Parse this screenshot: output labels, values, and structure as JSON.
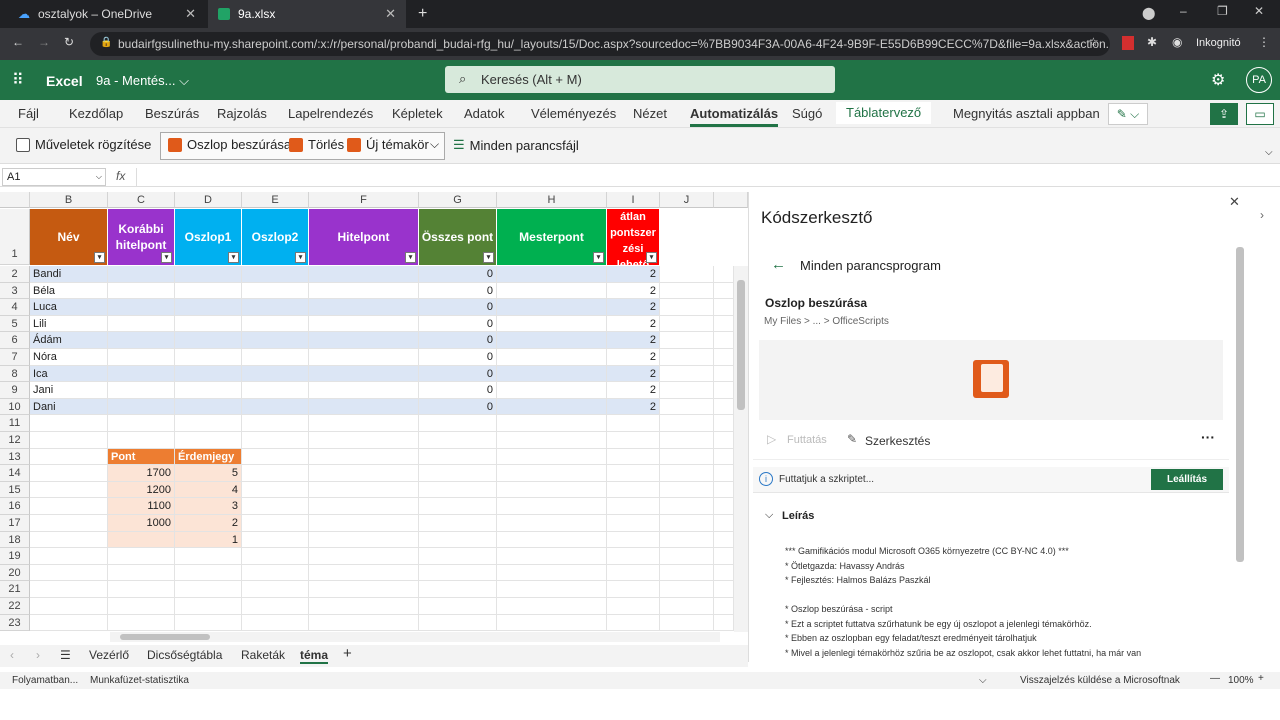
{
  "browser": {
    "tabs": [
      {
        "label": "osztalyok – OneDrive"
      },
      {
        "label": "9a.xlsx"
      }
    ],
    "url": "budairfgsulinethu-my.sharepoint.com/:x:/r/personal/probandi_budai-rfg_hu/_layouts/15/Doc.aspx?sourcedoc=%7BB9034F3A-00A6-4F24-9B9F-E55D6B99CECC%7D&file=9a.xlsx&action...",
    "profile": "Inkognitó"
  },
  "app": {
    "name": "Excel",
    "doc_title": "9a - Mentés... ⌵",
    "search_placeholder": "Keresés (Alt + M)",
    "avatar": "PA"
  },
  "menu": [
    "Fájl",
    "Kezdőlap",
    "Beszúrás",
    "Rajzolás",
    "Lapelrendezés",
    "Képletek",
    "Adatok",
    "Véleményezés",
    "Nézet",
    "Automatizálás",
    "Súgó",
    "Táblatervező"
  ],
  "menu_extra": "Megnyitás asztali appban",
  "ribbon": {
    "record": "Műveletek rögzítése",
    "insert_col": "Oszlop beszúrása",
    "delete": "Törlés",
    "new_topic": "Új témakör",
    "all_scripts": "Minden parancsfájl"
  },
  "formula": {
    "namebox": "A1",
    "fx": "fx"
  },
  "columns": [
    "B",
    "C",
    "D",
    "E",
    "F",
    "G",
    "H",
    "I",
    "J"
  ],
  "headers": [
    "Név",
    "Korábbi hitelpont",
    "Oszlop1",
    "Oszlop2",
    "Hitelpont",
    "Összes pont",
    "Mesterpont",
    "átlan pontszer zési lehető"
  ],
  "rows": [
    {
      "name": "Bandi",
      "total": "0",
      "i": "2"
    },
    {
      "name": "Béla",
      "total": "0",
      "i": "2"
    },
    {
      "name": "Luca",
      "total": "0",
      "i": "2"
    },
    {
      "name": "Lili",
      "total": "0",
      "i": "2"
    },
    {
      "name": "Ádám",
      "total": "0",
      "i": "2"
    },
    {
      "name": "Nóra",
      "total": "0",
      "i": "2"
    },
    {
      "name": "Ica",
      "total": "0",
      "i": "2"
    },
    {
      "name": "Jani",
      "total": "0",
      "i": "2"
    },
    {
      "name": "Dani",
      "total": "0",
      "i": "2"
    }
  ],
  "row_numbers": [
    "1",
    "2",
    "3",
    "4",
    "5",
    "6",
    "7",
    "8",
    "9",
    "10",
    "11",
    "12",
    "13",
    "14",
    "15",
    "16",
    "17",
    "18",
    "19",
    "20",
    "21",
    "22",
    "23"
  ],
  "small_table": {
    "headers": [
      "Pont",
      "Érdemjegy"
    ],
    "rows": [
      [
        "1700",
        "5"
      ],
      [
        "1200",
        "4"
      ],
      [
        "1100",
        "3"
      ],
      [
        "1000",
        "2"
      ],
      [
        "",
        "1"
      ]
    ]
  },
  "sheets": [
    "Vezérlő",
    "Dicsőségtábla",
    "Raketák",
    "téma"
  ],
  "panel": {
    "title": "Kódszerkesztő",
    "back_label": "Minden parancsprogram",
    "script_name": "Oszlop beszúrása",
    "path": "My Files  >  ...  >  OfficeScripts",
    "run": "Futtatás",
    "edit": "Szerkesztés",
    "info": "Futtatjuk a szkriptet...",
    "stop": "Leállítás",
    "desc_title": "Leírás",
    "desc_lines": [
      "*** Gamifikációs modul Microsoft O365 környezetre (CC BY-NC 4.0) ***",
      "* Ötletgazda: Havassy András",
      "* Fejlesztés: Halmos Balázs Paszkál",
      "",
      "* Oszlop beszúrása - script",
      "* Ezt a scriptet futtatva szűrhatunk be egy új oszlopot a jelenlegi témakörhöz.",
      "* Ebben az oszlopban egy feladat/teszt eredményeit tárolhatjuk",
      "* Mivel a jelenlegi témakörhöz szűria be az oszlopot, csak akkor lehet futtatni, ha már van"
    ]
  },
  "status": {
    "left1": "Folyamatban...",
    "left2": "Munkafüzet-statisztika",
    "feedback": "Visszajelzés küldése a Microsoftnak",
    "zoom": "100%"
  },
  "colors": {
    "excel_green": "#217346",
    "name_col": "#c55a11",
    "purple": "#9933cc",
    "blue": "#00b0f0",
    "green_dark": "#548235",
    "green": "#00b050",
    "red": "#ff0000",
    "band": "#dce6f5",
    "orange_light": "#fce4d6",
    "orange": "#ed7d31"
  }
}
